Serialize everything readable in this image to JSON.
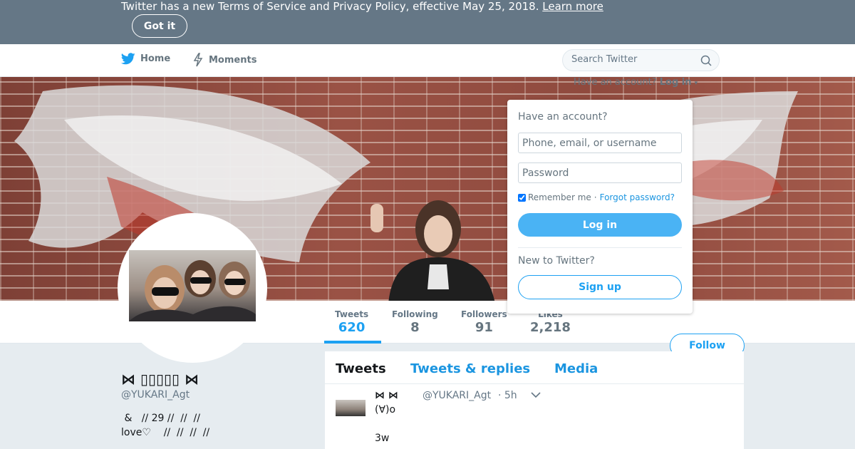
{
  "notice": {
    "text": "Twitter has a new Terms of Service and Privacy Policy, effective May 25, 2018.",
    "link": "Learn more",
    "button": "Got it"
  },
  "nav": {
    "home": "Home",
    "moments": "Moments",
    "search_placeholder": "Search Twitter",
    "have_account": "Have an account?",
    "login_link": "Log in"
  },
  "login_dropdown": {
    "title": "Have an account?",
    "username_placeholder": "Phone, email, or username",
    "password_placeholder": "Password",
    "remember_me": "Remember me",
    "separator": "·",
    "forgot_password": "Forgot password?",
    "login_button": "Log in",
    "new_to_twitter": "New to Twitter?",
    "signup_button": "Sign up"
  },
  "stats": [
    {
      "label": "Tweets",
      "value": "620"
    },
    {
      "label": "Following",
      "value": "8"
    },
    {
      "label": "Followers",
      "value": "91"
    },
    {
      "label": "Likes",
      "value": "2,218"
    }
  ],
  "follow_button": "Follow",
  "profile": {
    "name": "⋈ ▯▯▯▯▯ ⋈",
    "handle": "@YUKARI_Agt",
    "bio_line1": " &   // 29 //  //  //",
    "bio_line2": "love♡    //  //  //  //"
  },
  "timeline": {
    "tabs": [
      "Tweets",
      "Tweets & replies",
      "Media"
    ]
  },
  "tweet": {
    "name": "⋈  ⋈",
    "handle": "@YUKARI_Agt",
    "time": "· 5h",
    "line1": "(∀)o",
    "line2": "3w"
  },
  "colors": {
    "brand_blue": "#1da1f2",
    "notice_bg": "#657786",
    "page_bg": "#e6ecf0"
  }
}
